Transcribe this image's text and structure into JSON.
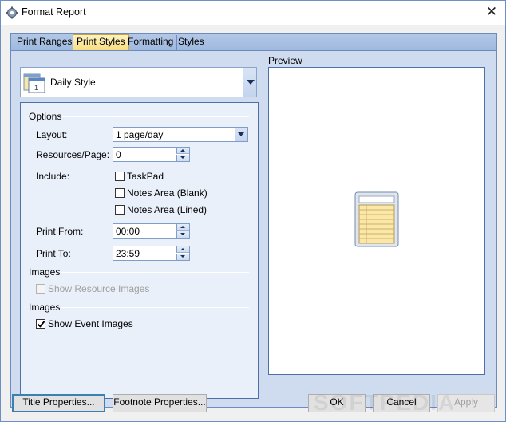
{
  "window": {
    "title": "Format Report",
    "close_glyph": "✕"
  },
  "tabs": [
    {
      "label": "Print Ranges",
      "active": false
    },
    {
      "label": "Print Styles",
      "active": true
    },
    {
      "label": "Formatting",
      "active": false
    },
    {
      "label": "Styles",
      "active": false
    }
  ],
  "style_selector": {
    "value": "Daily Style",
    "icon": "calendar-icon"
  },
  "options": {
    "group_title": "Options",
    "layout": {
      "label": "Layout:",
      "value": "1 page/day"
    },
    "resources_per_page": {
      "label": "Resources/Page:",
      "value": "0"
    },
    "include": {
      "label": "Include:",
      "items": [
        {
          "label": "TaskPad",
          "checked": false
        },
        {
          "label": "Notes Area (Blank)",
          "checked": false
        },
        {
          "label": "Notes Area (Lined)",
          "checked": false
        }
      ]
    },
    "print_from": {
      "label": "Print From:",
      "value": "00:00"
    },
    "print_to": {
      "label": "Print To:",
      "value": "23:59"
    }
  },
  "images_group_1": {
    "title": "Images",
    "checkbox": {
      "label": "Show Resource Images",
      "checked": false,
      "enabled": false
    }
  },
  "images_group_2": {
    "title": "Images",
    "checkbox": {
      "label": "Show Event Images",
      "checked": true,
      "enabled": true
    }
  },
  "preview": {
    "label": "Preview",
    "icon": "report-page-icon"
  },
  "buttons": {
    "title_properties": "Title Properties...",
    "footnote_properties": "Footnote Properties...",
    "ok": "OK",
    "cancel": "Cancel",
    "apply": "Apply"
  },
  "watermark": "SOFTPEDIA",
  "colors": {
    "tab_active": "#f8dc7a",
    "panel_blue": "#cfdcf0",
    "border_blue": "#4f6fa8"
  }
}
